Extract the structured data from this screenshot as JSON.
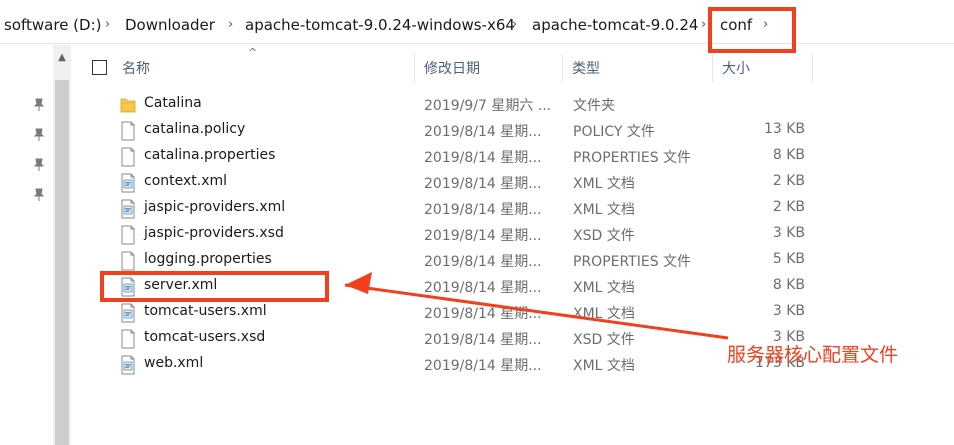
{
  "breadcrumb": {
    "items": [
      "software (D:)",
      "Downloader",
      "apache-tomcat-9.0.24-windows-x64",
      "apache-tomcat-9.0.24",
      "conf"
    ],
    "separator": "›"
  },
  "columns": {
    "name": "名称",
    "date": "修改日期",
    "type": "类型",
    "size": "大小"
  },
  "files": [
    {
      "name": "Catalina",
      "date": "2019/9/7 星期六 ...",
      "type": "文件夹",
      "size": "",
      "icon": "folder-icon"
    },
    {
      "name": "catalina.policy",
      "date": "2019/8/14 星期...",
      "type": "POLICY 文件",
      "size": "13 KB",
      "icon": "file-icon"
    },
    {
      "name": "catalina.properties",
      "date": "2019/8/14 星期...",
      "type": "PROPERTIES 文件",
      "size": "8 KB",
      "icon": "file-icon"
    },
    {
      "name": "context.xml",
      "date": "2019/8/14 星期...",
      "type": "XML 文档",
      "size": "2 KB",
      "icon": "xml-file-icon"
    },
    {
      "name": "jaspic-providers.xml",
      "date": "2019/8/14 星期...",
      "type": "XML 文档",
      "size": "2 KB",
      "icon": "xml-file-icon"
    },
    {
      "name": "jaspic-providers.xsd",
      "date": "2019/8/14 星期...",
      "type": "XSD 文件",
      "size": "3 KB",
      "icon": "file-icon"
    },
    {
      "name": "logging.properties",
      "date": "2019/8/14 星期...",
      "type": "PROPERTIES 文件",
      "size": "5 KB",
      "icon": "file-icon"
    },
    {
      "name": "server.xml",
      "date": "2019/8/14 星期...",
      "type": "XML 文档",
      "size": "8 KB",
      "icon": "xml-file-icon"
    },
    {
      "name": "tomcat-users.xml",
      "date": "2019/8/14 星期...",
      "type": "XML 文档",
      "size": "3 KB",
      "icon": "xml-file-icon"
    },
    {
      "name": "tomcat-users.xsd",
      "date": "2019/8/14 星期...",
      "type": "XSD 文件",
      "size": "3 KB",
      "icon": "file-icon"
    },
    {
      "name": "web.xml",
      "date": "2019/8/14 星期...",
      "type": "XML 文档",
      "size": "173 KB",
      "icon": "xml-file-icon"
    }
  ],
  "annotation": {
    "text": "服务器核心配置文件",
    "color": "#f0401e"
  }
}
